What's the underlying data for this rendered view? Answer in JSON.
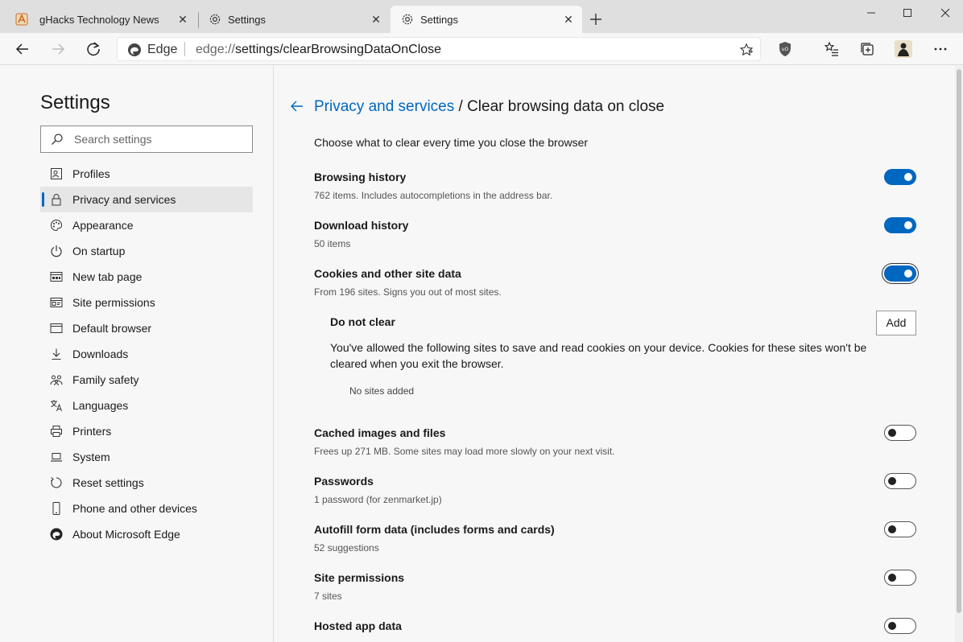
{
  "browser": {
    "tabs": [
      {
        "title": "gHacks Technology News",
        "icon": "ghacks-favicon",
        "close": "✕"
      },
      {
        "title": "Settings",
        "icon": "gear-icon",
        "close": "✕"
      },
      {
        "title": "Settings",
        "icon": "gear-icon",
        "close": "✕",
        "active": true
      }
    ],
    "address": {
      "label": "Edge",
      "url_scheme": "edge://",
      "url_rest": "settings/clearBrowsingDataOnClose"
    },
    "colors": {
      "accent": "#0067c0",
      "tabbar": "#dfdfdf",
      "page": "#f7f7f7"
    }
  },
  "sidebar": {
    "title": "Settings",
    "search_placeholder": "Search settings",
    "items": [
      {
        "label": "Profiles",
        "icon": "profile-icon"
      },
      {
        "label": "Privacy and services",
        "icon": "lock-icon",
        "active": true
      },
      {
        "label": "Appearance",
        "icon": "palette-icon"
      },
      {
        "label": "On startup",
        "icon": "power-icon"
      },
      {
        "label": "New tab page",
        "icon": "newtab-icon"
      },
      {
        "label": "Site permissions",
        "icon": "site-permissions-icon"
      },
      {
        "label": "Default browser",
        "icon": "default-browser-icon"
      },
      {
        "label": "Downloads",
        "icon": "download-icon"
      },
      {
        "label": "Family safety",
        "icon": "family-icon"
      },
      {
        "label": "Languages",
        "icon": "languages-icon"
      },
      {
        "label": "Printers",
        "icon": "printer-icon"
      },
      {
        "label": "System",
        "icon": "laptop-icon"
      },
      {
        "label": "Reset settings",
        "icon": "reset-icon"
      },
      {
        "label": "Phone and other devices",
        "icon": "phone-icon"
      },
      {
        "label": "About Microsoft Edge",
        "icon": "edge-logo-icon"
      }
    ]
  },
  "main": {
    "breadcrumb_link": "Privacy and services",
    "breadcrumb_sep": " / ",
    "breadcrumb_current": "Clear browsing data on close",
    "description": "Choose what to clear every time you close the browser",
    "settings": [
      {
        "title": "Browsing history",
        "subtitle": "762 items. Includes autocompletions in the address bar.",
        "on": true
      },
      {
        "title": "Download history",
        "subtitle": "50 items",
        "on": true
      },
      {
        "title": "Cookies and other site data",
        "subtitle": "From 196 sites. Signs you out of most sites.",
        "on": true
      },
      {
        "title": "Cached images and files",
        "subtitle": "Frees up 271 MB. Some sites may load more slowly on your next visit.",
        "on": false
      },
      {
        "title": "Passwords",
        "subtitle": "1 password (for zenmarket.jp)",
        "on": false
      },
      {
        "title": "Autofill form data (includes forms and cards)",
        "subtitle": "52 suggestions",
        "on": false
      },
      {
        "title": "Site permissions",
        "subtitle": "7 sites",
        "on": false
      },
      {
        "title": "Hosted app data",
        "subtitle": "",
        "on": false
      }
    ],
    "do_not_clear": {
      "title": "Do not clear",
      "add_label": "Add",
      "text": "You've allowed the following sites to save and read cookies on your device. Cookies for these sites won't be cleared when you exit the browser.",
      "empty": "No sites added"
    }
  }
}
